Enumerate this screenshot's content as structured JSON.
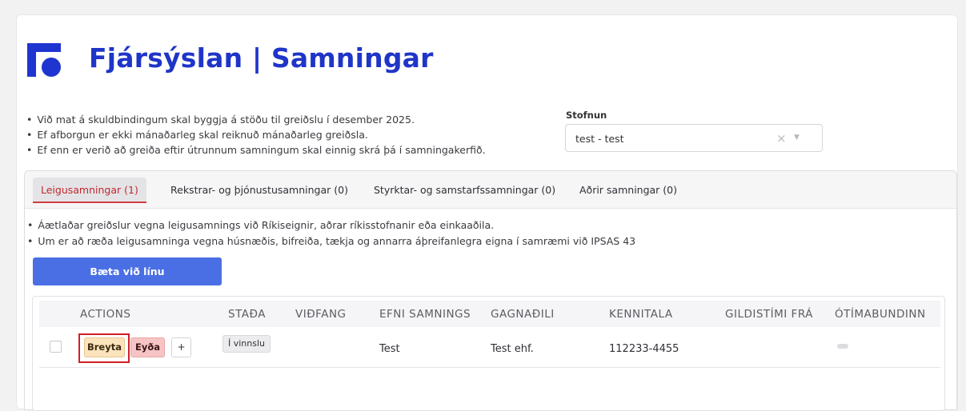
{
  "header": {
    "title": "Fjársýslan | Samningar"
  },
  "notes": [
    "Við mat á skuldbindingum skal byggja á stöðu til greiðslu í desember 2025.",
    "Ef afborgun er ekki mánaðarleg skal reiknuð mánaðarleg greiðsla.",
    "Ef enn er verið að greiða eftir útrunnum samningum skal einnig skrá þá í samningakerfið."
  ],
  "stofnun": {
    "label": "Stofnun",
    "value": "test - test",
    "clear_icon": "×",
    "caret_icon": "▼"
  },
  "tabs": [
    {
      "label": "Leigusamningar (1)",
      "active": true
    },
    {
      "label": "Rekstrar- og þjónustusamningar (0)",
      "active": false
    },
    {
      "label": "Styrktar- og samstarfssamningar (0)",
      "active": false
    },
    {
      "label": "Aðrir samningar (0)",
      "active": false
    }
  ],
  "tab_notes": [
    "Áætlaðar greiðslur vegna leigusamnings við Ríkiseignir, aðrar ríkisstofnanir eða einkaaðila.",
    "Um er að ræða leigusamninga vegna húsnæðis, bifreiða, tækja og annarra áþreifanlegra eigna í samræmi við IPSAS 43"
  ],
  "add_button": "Bæta við línu",
  "table": {
    "columns": [
      "ACTIONS",
      "STAÐA",
      "VIÐFANG",
      "EFNI SAMNINGS",
      "GAGNAÐILI",
      "KENNITALA",
      "GILDISTÍMI FRÁ",
      "ÓTÍMABUNDINN"
    ],
    "rows": [
      {
        "actions": {
          "edit": "Breyta",
          "delete": "Eyða",
          "more": "+"
        },
        "stada": "Í vinnslu",
        "vidfang": "",
        "efni_samnings": "Test",
        "gagnadili": "Test ehf.",
        "kennitala": "112233-4455",
        "gildistimi_fra": ""
      }
    ]
  },
  "colors": {
    "brand": "#1f35c8",
    "primary_button": "#4a6fe4",
    "active_tab_text": "#c1272d",
    "highlight_border": "#d01f27"
  }
}
